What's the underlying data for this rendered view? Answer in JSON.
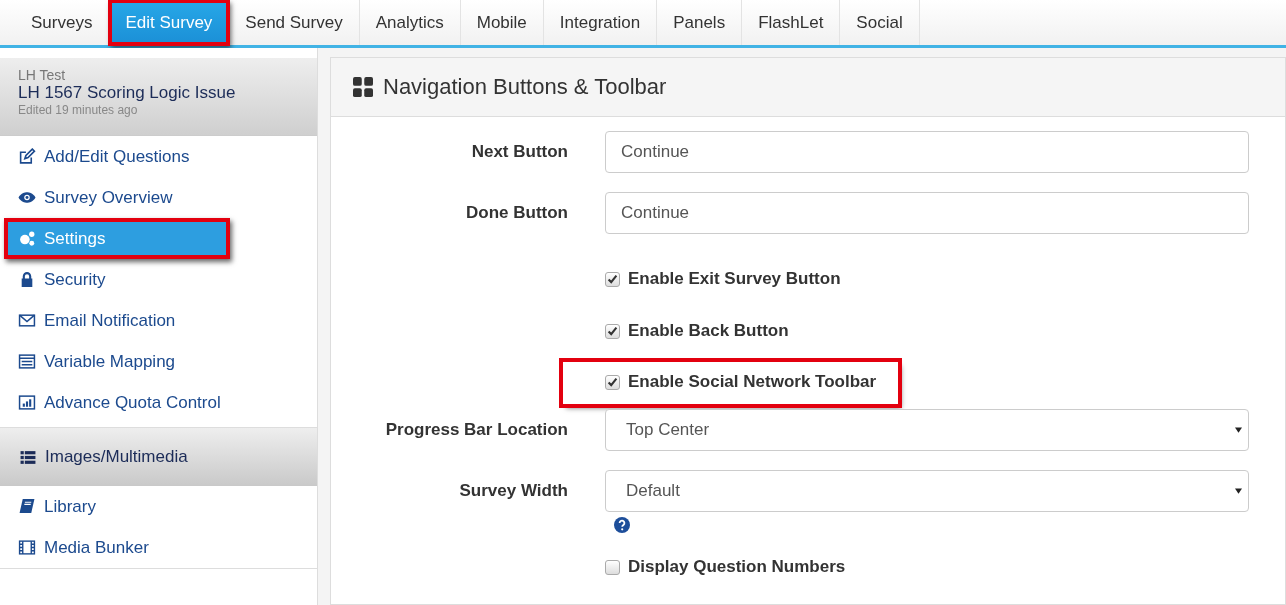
{
  "tabs": [
    {
      "label": "Surveys",
      "selected": false,
      "highlighted": false
    },
    {
      "label": "Edit Survey",
      "selected": true,
      "highlighted": true
    },
    {
      "label": "Send Survey",
      "selected": false,
      "highlighted": false
    },
    {
      "label": "Analytics",
      "selected": false,
      "highlighted": false
    },
    {
      "label": "Mobile",
      "selected": false,
      "highlighted": false
    },
    {
      "label": "Integration",
      "selected": false,
      "highlighted": false
    },
    {
      "label": "Panels",
      "selected": false,
      "highlighted": false
    },
    {
      "label": "FlashLet",
      "selected": false,
      "highlighted": false
    },
    {
      "label": "Social",
      "selected": false,
      "highlighted": false
    }
  ],
  "survey": {
    "folder": "LH Test",
    "title": "LH 1567 Scoring Logic Issue",
    "edited": "Edited 19 minutes ago"
  },
  "sidebar": {
    "items": [
      {
        "label": "Add/Edit Questions",
        "selected": false,
        "highlighted": false
      },
      {
        "label": "Survey Overview",
        "selected": false,
        "highlighted": false
      },
      {
        "label": "Settings",
        "selected": true,
        "highlighted": true
      },
      {
        "label": "Security",
        "selected": false,
        "highlighted": false
      },
      {
        "label": "Email Notification",
        "selected": false,
        "highlighted": false
      },
      {
        "label": "Variable Mapping",
        "selected": false,
        "highlighted": false
      },
      {
        "label": "Advance Quota Control",
        "selected": false,
        "highlighted": false
      }
    ],
    "section": {
      "label": "Images/Multimedia"
    },
    "section_items": [
      {
        "label": "Library",
        "selected": false
      },
      {
        "label": "Media Bunker",
        "selected": false
      }
    ]
  },
  "panel": {
    "title": "Navigation Buttons & Toolbar",
    "rows": [
      {
        "kind": "text",
        "label": "Next Button",
        "value": "Continue"
      },
      {
        "kind": "text",
        "label": "Done Button",
        "value": "Continue"
      },
      {
        "kind": "checkbox",
        "label": "Enable Exit Survey Button",
        "checked": true,
        "highlighted": false
      },
      {
        "kind": "checkbox",
        "label": "Enable Back Button",
        "checked": true,
        "highlighted": false
      },
      {
        "kind": "checkbox",
        "label": "Enable Social Network Toolbar",
        "checked": true,
        "highlighted": true
      },
      {
        "kind": "select",
        "label": "Progress Bar Location",
        "value": "Top Center"
      },
      {
        "kind": "select",
        "label": "Survey Width",
        "value": "Default",
        "help": true
      },
      {
        "kind": "checkbox",
        "label": "Display Question Numbers",
        "checked": false,
        "highlighted": false
      }
    ]
  }
}
